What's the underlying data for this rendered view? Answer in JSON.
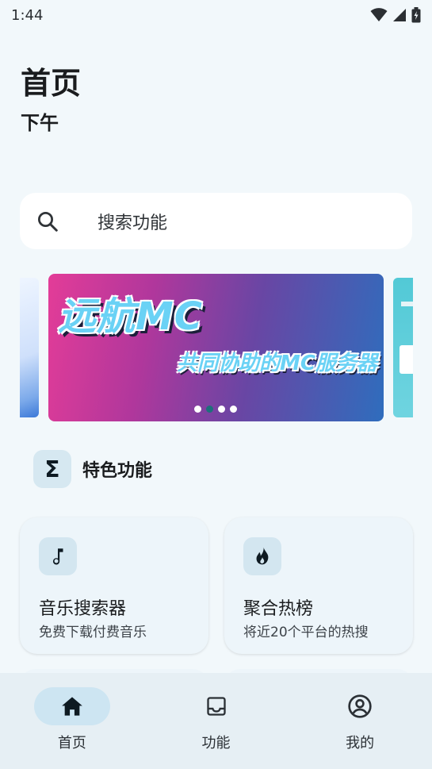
{
  "status_bar": {
    "time": "1:44"
  },
  "page": {
    "title": "首页",
    "subtitle": "下午"
  },
  "search": {
    "placeholder": "搜索功能"
  },
  "banner": {
    "title": "远航MC",
    "subtitle": "共同协助的MC服务器",
    "dot_count": 4,
    "active_dot": 1
  },
  "section": {
    "icon_glyph": "Σ",
    "title": "特色功能"
  },
  "features": [
    {
      "icon": "music-note-icon",
      "title": "音乐搜索器",
      "desc": "免费下载付费音乐"
    },
    {
      "icon": "fire-icon",
      "title": "聚合热榜",
      "desc": "将近20个平台的热搜"
    }
  ],
  "bottom_nav": [
    {
      "icon": "home-icon",
      "label": "首页",
      "active": true
    },
    {
      "icon": "inbox-icon",
      "label": "功能",
      "active": false
    },
    {
      "icon": "account-icon",
      "label": "我的",
      "active": false
    }
  ],
  "colors": {
    "background": "#f2f8fb",
    "active_dot": "#1d6f7b",
    "nav_background": "#e6eff4",
    "nav_active_pill": "#cde5f2"
  }
}
